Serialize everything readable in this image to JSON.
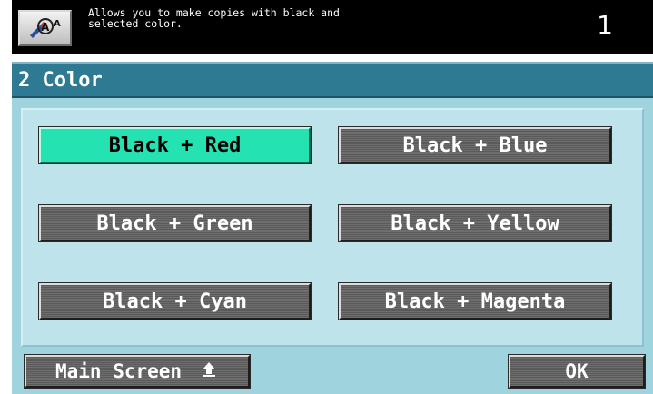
{
  "header": {
    "help_icon": "copy-help-icon",
    "message": "Allows you to make copies with black and\nselected color.",
    "counter": "1"
  },
  "screen": {
    "title": "2 Color"
  },
  "options": [
    {
      "label": "Black + Red",
      "selected": true
    },
    {
      "label": "Black + Blue",
      "selected": false
    },
    {
      "label": "Black + Green",
      "selected": false
    },
    {
      "label": "Black + Yellow",
      "selected": false
    },
    {
      "label": "Black + Cyan",
      "selected": false
    },
    {
      "label": "Black + Magenta",
      "selected": false
    }
  ],
  "footer": {
    "main_screen_label": "Main Screen",
    "main_screen_icon": "return-arrow-icon",
    "ok_label": "OK"
  },
  "colors": {
    "selected": "#24e2b2",
    "panel": "#9fd3de",
    "title_bar": "#2f7a93",
    "button": "#666666"
  }
}
